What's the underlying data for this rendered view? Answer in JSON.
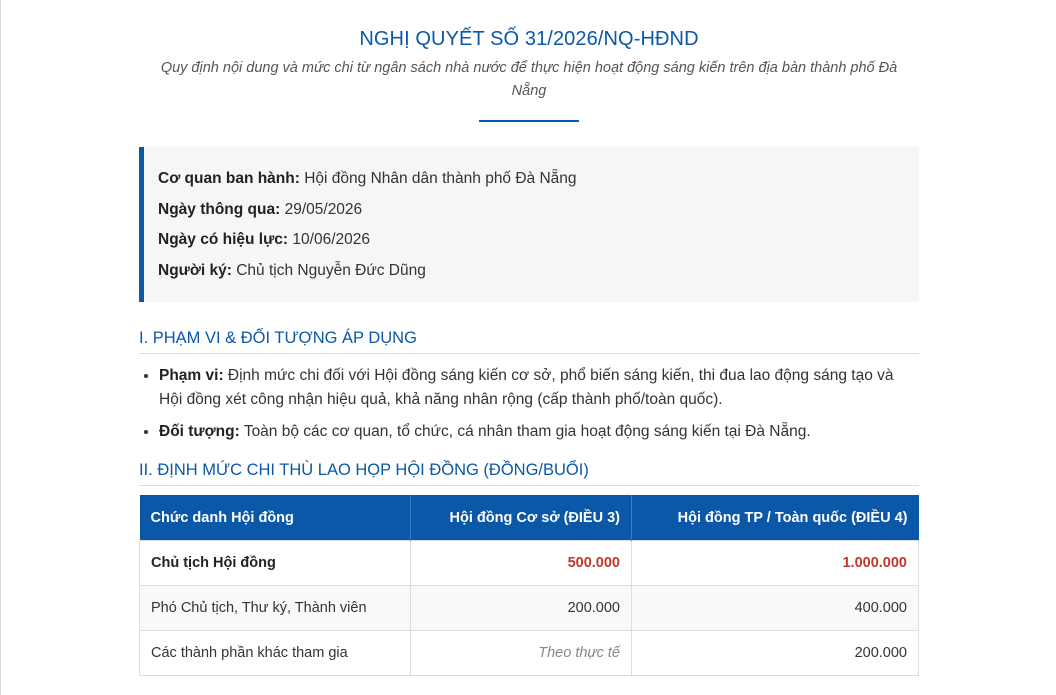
{
  "document": {
    "title": "NGHỊ QUYẾT SỐ 31/2026/NQ-HĐND",
    "subtitle": "Quy định nội dung và mức chi từ ngân sách nhà nước để thực hiện hoạt động sáng kiến trên địa bàn thành phố Đà Nẵng"
  },
  "info": [
    {
      "label": "Cơ quan ban hành:",
      "value": "Hội đồng Nhân dân thành phố Đà Nẵng"
    },
    {
      "label": "Ngày thông qua:",
      "value": "29/05/2026"
    },
    {
      "label": "Ngày có hiệu lực:",
      "value": "10/06/2026"
    },
    {
      "label": "Người ký:",
      "value": "Chủ tịch Nguyễn Đức Dũng"
    }
  ],
  "section1": {
    "heading": "I. PHẠM VI & ĐỐI TƯỢNG ÁP DỤNG",
    "items": [
      {
        "label": "Phạm vi:",
        "text": "Định mức chi đối với Hội đồng sáng kiến cơ sở, phổ biến sáng kiến, thi đua lao động sáng tạo và Hội đồng xét công nhận hiệu quả, khả năng nhân rộng (cấp thành phố/toàn quốc)."
      },
      {
        "label": "Đối tượng:",
        "text": "Toàn bộ các cơ quan, tổ chức, cá nhân tham gia hoạt động sáng kiến tại Đà Nẵng."
      }
    ]
  },
  "section2": {
    "heading": "II. ĐỊNH MỨC CHI THÙ LAO HỌP HỘI ĐỒNG (ĐỒNG/BUỔI)",
    "table": {
      "headers": [
        "Chức danh Hội đồng",
        "Hội đồng Cơ sở (ĐIỀU 3)",
        "Hội đồng TP / Toàn quốc (ĐIỀU 4)"
      ],
      "rows": [
        {
          "role": "Chủ tịch Hội đồng",
          "base": "500.000",
          "city": "1.000.000"
        },
        {
          "role": "Phó Chủ tịch, Thư ký, Thành viên",
          "base": "200.000",
          "city": "400.000"
        },
        {
          "role": "Các thành phần khác tham gia",
          "base": "Theo thực tế",
          "city": "200.000"
        }
      ]
    }
  },
  "colors": {
    "accent": "#0b58a8",
    "highlight": "#c0392b",
    "info_bg": "#f4f6f8"
  }
}
